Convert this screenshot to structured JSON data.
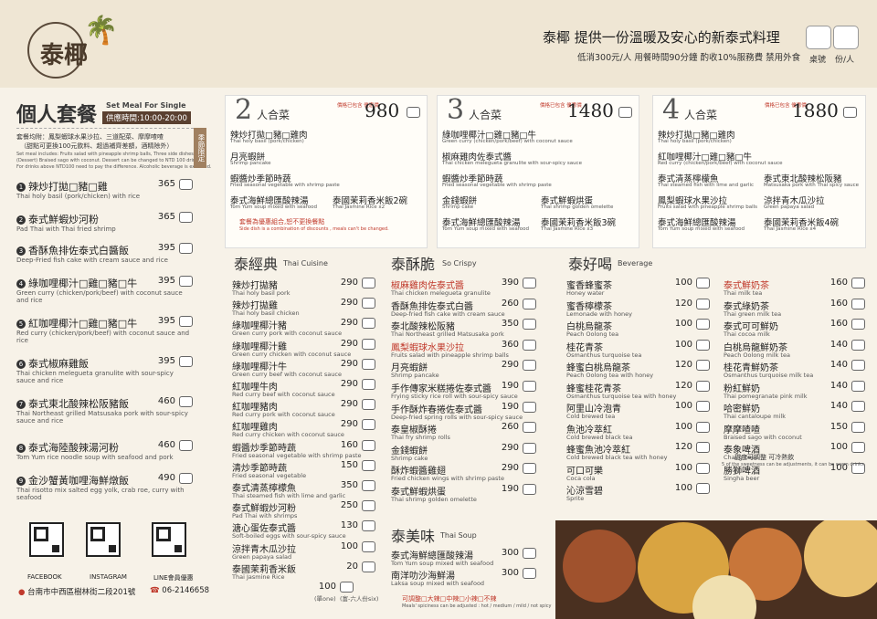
{
  "header": {
    "logo_text": "泰椰",
    "slogan": "泰椰 提供一份溫暖及安心的新泰式料理",
    "subslogan": "低消300元/人  用餐時間90分鐘  酌收10%服務費  禁用外食",
    "table_label": "桌號",
    "people_label": "份/人"
  },
  "single": {
    "title": "個人套餐",
    "title_en": "Set Meal For Single",
    "hours": "供應時間:10:00-20:00",
    "desc_zh": "套餐均附：鳳梨蝦球水果沙拉、三道配菜、摩摩喳喳",
    "desc_zh2": "（甜點可更換100元飲料、超過補齊差額，酒精除外）",
    "desc_en": "Set meal includes: Fruits salad with pineapple shrimp balls, Three side dishes,",
    "desc_en2": "(Dessert) Braised sago with coconut. Dessert can be changed to NTD 100 drink.",
    "desc_en3": "For drinks above NTD100 need to pay the difference. Alcoholic beverage is excluded.",
    "tag": "季節限定",
    "items": [
      {
        "n": "1",
        "name": "辣炒打拋",
        "opts": "□豬□雞",
        "en": "Thai holy basil (pork/chicken) with rice",
        "price": "365"
      },
      {
        "n": "2",
        "name": "泰式鮮蝦炒河粉",
        "opts": "",
        "en": "Pad Thai with Thai fried shrimp",
        "price": "365"
      },
      {
        "n": "3",
        "name": "香酥魚排佐泰式白醬飯",
        "opts": "",
        "en": "Deep-Fried fish cake with cream sauce and rice",
        "price": "395"
      },
      {
        "n": "4",
        "name": "綠咖哩椰汁",
        "opts": "□雞□豬□牛",
        "en": "Green curry (chicken/pork/beef) with coconut sauce and rice",
        "price": "395"
      },
      {
        "n": "5",
        "name": "紅咖哩椰汁",
        "opts": "□雞□豬□牛",
        "en": "Red curry (chicken/pork/beef) with coconut sauce and rice",
        "price": "395"
      },
      {
        "n": "6",
        "name": "泰式椒麻雞飯",
        "opts": "",
        "en": "Thai chicken melegueta granulite with sour-spicy sauce and rice",
        "price": "395"
      },
      {
        "n": "7",
        "name": "泰式東北酸辣松阪豬飯",
        "opts": "",
        "en": "Thai Northeast grilled Matsusaka pork with sour-spicy sauce and rice",
        "price": "460"
      },
      {
        "n": "8",
        "name": "泰式海陸酸辣湯河粉",
        "opts": "",
        "en": "Tom Yum rice noodle soup with seafood and pork",
        "price": "460"
      },
      {
        "n": "9",
        "name": "金沙蟹黃咖哩海鮮燉飯",
        "opts": "",
        "en": "Thai risotto mix salted egg yolk, crab roe, curry with seafood",
        "price": "490"
      }
    ]
  },
  "sets": [
    {
      "num": "2",
      "label": "人合菜",
      "note": "價格已包含\n優惠價",
      "price": "980",
      "items": [
        {
          "name": "辣炒打拋□豬□雞肉",
          "en": "Thai holy basil (pork/chicken)"
        },
        {
          "name": "月亮蝦餅",
          "en": "Shrimp pancake"
        },
        {
          "name": "蝦醬炒季節時蔬",
          "en": "Fried seasonal vegetable with shrimp paste"
        },
        {
          "name": "泰式海鮮總匯酸辣湯",
          "en": "Tom Yum soup mixed with seafood"
        },
        {
          "name": "泰國茉莉香米飯2碗",
          "en": "Thai Jasmine Rice x2"
        }
      ],
      "footer": "套餐為優惠組合,恕不更換餐點",
      "footer_en": "Side dish is a combination of discounts , meals can't be changed."
    },
    {
      "num": "3",
      "label": "人合菜",
      "note": "價格已包含\n優惠價",
      "price": "1480",
      "items": [
        {
          "name": "綠咖哩椰汁□雞□豬□牛",
          "en": "Green curry (chicken/pork/beef) with coconut sauce"
        },
        {
          "name": "椒麻雞肉佐泰式醬",
          "en": "Thai chicken melegueta granulite with sour-spicy sauce"
        },
        {
          "name": "蝦醬炒季節時蔬",
          "en": "Fried seasonal vegetable with shrimp paste"
        },
        {
          "name": "金錢蝦餅",
          "en": "Shrimp cake"
        },
        {
          "name": "泰式鮮蝦烘蛋",
          "en": "Thai shrimp golden omelette"
        },
        {
          "name": "泰式海鮮總匯酸辣湯",
          "en": "Tom Yum soup mixed with seafood"
        },
        {
          "name": "泰國茉莉香米飯3碗",
          "en": "Thai Jasmine Rice x3"
        }
      ]
    },
    {
      "num": "4",
      "label": "人合菜",
      "note": "價格已包含\n優惠價",
      "price": "1880",
      "items": [
        {
          "name": "辣炒打拋□豬□雞肉",
          "en": "Thai holy basil (pork/chicken)"
        },
        {
          "name": "紅咖哩椰汁□雞□豬□牛",
          "en": "Red curry (chicken/pork/beef) with coconut sauce"
        },
        {
          "name": "泰式清蒸檸檬魚",
          "en": "Thai steamed fish with lime and garlic"
        },
        {
          "name": "泰式東北酸辣松阪豬",
          "en": "Matsusaka pork with Thai spicy sauce"
        },
        {
          "name": "鳳梨蝦球水果沙拉",
          "en": "Fruits salad with pineapple shrimp balls"
        },
        {
          "name": "涼拌青木瓜沙拉",
          "en": "Green papaya salad"
        },
        {
          "name": "泰式海鮮總匯酸辣湯",
          "en": "Tom Yum soup mixed with seafood"
        },
        {
          "name": "泰國茉莉香米飯4碗",
          "en": "Thai Jasmine Rice x4"
        }
      ]
    }
  ],
  "classic": {
    "title": "泰經典",
    "title_en": "Thai Cuisine",
    "items": [
      {
        "name": "辣炒打拋豬",
        "en": "Thai holy basil pork",
        "price": "290"
      },
      {
        "name": "辣炒打拋雞",
        "en": "Thai holy basil chicken",
        "price": "290"
      },
      {
        "name": "綠咖哩椰汁豬",
        "en": "Green curry pork with coconut sauce",
        "price": "290"
      },
      {
        "name": "綠咖哩椰汁雞",
        "en": "Green curry chicken with coconut sauce",
        "price": "290"
      },
      {
        "name": "綠咖哩椰汁牛",
        "en": "Green curry beef with coconut sauce",
        "price": "290"
      },
      {
        "name": "紅咖哩牛肉",
        "en": "Red curry beef with coconut sauce",
        "price": "290"
      },
      {
        "name": "紅咖哩豬肉",
        "en": "Red curry pork with coconut sauce",
        "price": "290"
      },
      {
        "name": "紅咖哩雞肉",
        "en": "Red curry chicken with coconut sauce",
        "price": "290"
      },
      {
        "name": "蝦醬炒季節時蔬",
        "en": "Fried seasonal vegetable with shrimp paste",
        "price": "160"
      },
      {
        "name": "清炒季節時蔬",
        "en": "Fried seasonal vegetable",
        "price": "150"
      },
      {
        "name": "泰式清蒸檸檬魚",
        "en": "Thai steamed fish with lime and garlic",
        "price": "350"
      },
      {
        "name": "泰式鮮蝦炒河粉",
        "en": "Pad Thai with shrimps",
        "price": "250"
      },
      {
        "name": "溏心蛋佐泰式醬",
        "en": "Soft-boiled eggs with sour-spicy sauce",
        "price": "130"
      },
      {
        "name": "涼拌青木瓜沙拉",
        "en": "Green papaya salad",
        "price": "100"
      },
      {
        "name": "泰國茉莉香米飯",
        "en": "Thai Jasmine Rice",
        "price": "20"
      }
    ],
    "rice_extra": "100",
    "rice_note1": "(單one)",
    "rice_note2": "(富-六人份six)"
  },
  "crispy": {
    "title": "泰酥脆",
    "title_en": "So Crispy",
    "items": [
      {
        "name": "椒麻雞肉佐泰式醬",
        "en": "Thai chicken melegueta granulite",
        "price": "390",
        "red": true
      },
      {
        "name": "香酥魚排佐泰式白醬",
        "en": "Deep-fried fish cake with cream sauce",
        "price": "260"
      },
      {
        "name": "泰北酸辣松阪豬",
        "en": "Thai Northeast grilled Matsusaka pork",
        "price": "350"
      },
      {
        "name": "鳳梨蝦球水果沙拉",
        "en": "Fruits salad with pineapple shrimp balls",
        "price": "360",
        "red": true
      },
      {
        "name": "月亮蝦餅",
        "en": "Shrimp pancake",
        "price": "290"
      },
      {
        "name": "手作傳家米糕捲佐泰式醬",
        "en": "Frying sticky rice roll with sour-spicy sauce",
        "price": "190"
      },
      {
        "name": "手作酥炸春捲佐泰式醬",
        "en": "Deep-fried spring rolls with sour-spicy sauce",
        "price": "190"
      },
      {
        "name": "泰皇椒酥捲",
        "en": "Thai fry shrimp rolls",
        "price": "260"
      },
      {
        "name": "金錢蝦餅",
        "en": "Shrimp cake",
        "price": "290"
      },
      {
        "name": "酥炸蝦醬雞翅",
        "en": "Fried chicken wings with shrimp paste",
        "price": "290"
      },
      {
        "name": "泰式鮮蝦烘蛋",
        "en": "Thai shrimp golden omelette",
        "price": "190"
      }
    ]
  },
  "soup": {
    "title": "泰美味",
    "title_en": "Thai Soup",
    "items": [
      {
        "name": "泰式海鮮總匯酸辣湯",
        "en": "Tom Yum soup mixed with seafood",
        "price": "300"
      },
      {
        "name": "南洋叻沙海鮮湯",
        "en": "Laksa soup mixed with seafood",
        "price": "300"
      }
    ],
    "spicy_note": "可調整□大辣□中辣□小辣□不辣",
    "spicy_note_en": "Meals' spiciness can be adjusted : hot / medium / mild / not spicy"
  },
  "drinks": {
    "title": "泰好喝",
    "title_en": "Beverage",
    "left": [
      {
        "name": "蜜香蜂蜜茶",
        "en": "Honey water",
        "price": "100"
      },
      {
        "name": "蜜香檸檬茶",
        "en": "Lemonade with honey",
        "price": "120"
      },
      {
        "name": "白桃烏龍茶",
        "en": "Peach Oolong tea",
        "price": "100"
      },
      {
        "name": "桂花青茶",
        "en": "Osmanthus turquoise tea",
        "price": "100"
      },
      {
        "name": "蜂蜜白桃烏龍茶",
        "en": "Peach Oolong tea with honey",
        "price": "120"
      },
      {
        "name": "蜂蜜桂花青茶",
        "en": "Osmanthus turquoise tea with honey",
        "price": "120"
      },
      {
        "name": "阿里山冷泡青",
        "en": "Cold brewed tea",
        "price": "100"
      },
      {
        "name": "魚池冷萃紅",
        "en": "Cold brewed black tea",
        "price": "100"
      },
      {
        "name": "蜂蜜魚池冷萃紅",
        "en": "Cold brewed black tea with honey",
        "price": "120"
      },
      {
        "name": "可口可樂",
        "en": "Coca cola",
        "price": "100"
      },
      {
        "name": "沁涼雪碧",
        "en": "Sprite",
        "price": "100"
      }
    ],
    "right": [
      {
        "name": "泰式鮮奶茶",
        "en": "Thai milk tea",
        "price": "160",
        "red": true
      },
      {
        "name": "泰式綠奶茶",
        "en": "Thai green milk tea",
        "price": "160"
      },
      {
        "name": "泰式可可鮮奶",
        "en": "Thai cocoa milk",
        "price": "160"
      },
      {
        "name": "白桃烏龍鮮奶茶",
        "en": "Peach Oolong milk tea",
        "price": "140"
      },
      {
        "name": "桂花青鮮奶茶",
        "en": "Osmanthus turquoise milk tea",
        "price": "140"
      },
      {
        "name": "粉紅鮮奶",
        "en": "Thai pomegranate pink milk",
        "price": "140"
      },
      {
        "name": "哈密鮮奶",
        "en": "Thai cantaloupe milk",
        "price": "140"
      },
      {
        "name": "摩摩喳喳",
        "en": "Braised sago with coconut",
        "price": "150"
      },
      {
        "name": "泰象啤酒",
        "en": "Chang beer",
        "price": "100"
      },
      {
        "name": "勝獅啤酒",
        "en": "Singha beer",
        "price": "100"
      }
    ],
    "sweet_note": "甜度可調整  可冷熱飲",
    "sweet_note_en": "5 of the sweetness can be adjustments, it can be warm drinks"
  },
  "footer": {
    "facebook": "FACEBOOK",
    "instagram": "INSTAGRAM",
    "line": "LINE會員優惠",
    "address": "台南市中西區樹林街二段201號",
    "phone": "06-2146658"
  }
}
